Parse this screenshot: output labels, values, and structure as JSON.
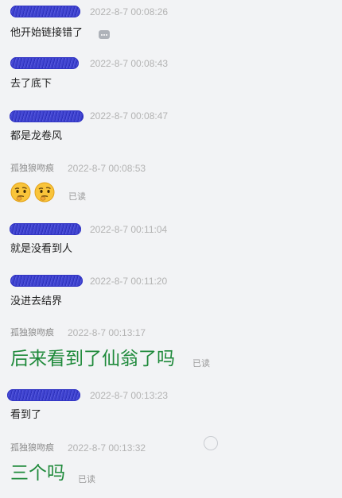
{
  "messages": [
    {
      "sender": "",
      "time": "2022-8-7 00:08:26",
      "text": "他开始链接错了"
    },
    {
      "sender": "",
      "time": "2022-8-7 00:08:43",
      "text": "去了底下"
    },
    {
      "sender": "",
      "time": "2022-8-7 00:08:47",
      "text": "都是龙卷风"
    },
    {
      "sender": "孤独狼吻痕",
      "time": "2022-8-7 00:08:53",
      "emojis": [
        "thinking-face",
        "thinking-face"
      ],
      "status": "已读"
    },
    {
      "sender": "",
      "time": "2022-8-7 00:11:04",
      "text": "就是没看到人"
    },
    {
      "sender": "",
      "time": "2022-8-7 00:11:20",
      "text": "没进去结界"
    },
    {
      "sender": "孤独狼吻痕",
      "time": "2022-8-7 00:13:17",
      "text": "后来看到了仙翁了吗",
      "status": "已读"
    },
    {
      "sender": "",
      "time": "2022-8-7 00:13:23",
      "text": "看到了"
    },
    {
      "sender": "孤独狼吻痕",
      "time": "2022-8-7 00:13:32",
      "text": "三个吗",
      "status": "已读"
    }
  ],
  "icons": {
    "more": "more-dots-icon",
    "emoji": "thinking-face-emoji",
    "select": "circle-select-icon"
  },
  "colors": {
    "background": "#f2f3f5",
    "scribble": "#3f43d1",
    "highlight_text": "#1f8a3b",
    "timestamp": "#b3b3b3"
  }
}
